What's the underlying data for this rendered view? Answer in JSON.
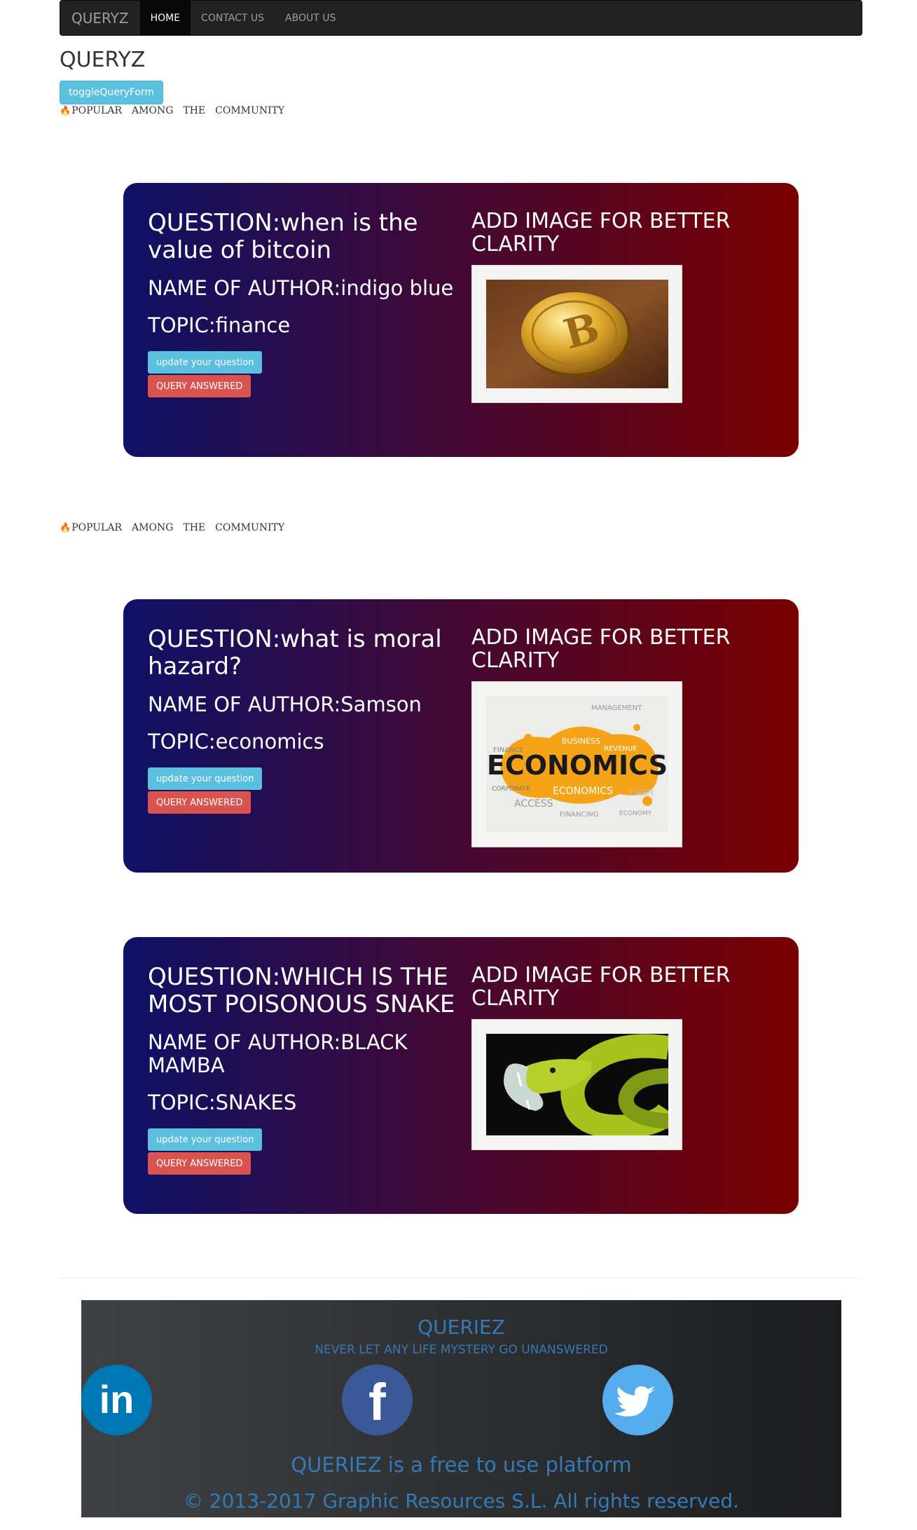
{
  "navbar": {
    "brand": "QUERYZ",
    "items": [
      {
        "label": "HOME",
        "active": true
      },
      {
        "label": "CONTACT US",
        "active": false
      },
      {
        "label": "ABOUT US",
        "active": false
      }
    ]
  },
  "page_title": "QUERYZ",
  "toggle_button": "toggleQueryForm",
  "popular_words": [
    "POPULAR",
    "AMONG",
    "THE",
    "COMMUNITY"
  ],
  "popular_icon": "fire-icon",
  "cards": [
    {
      "question": "QUESTION:when is the value of bitcoin",
      "author": "NAME OF AUTHOR:indigo blue",
      "topic": "TOPIC:finance",
      "update_label": "update your question",
      "answered_label": "QUERY ANSWERED",
      "add_image_label": "ADD IMAGE FOR BETTER CLARITY",
      "image": "bitcoin coin photo"
    },
    {
      "question": "QUESTION:what is moral hazard?",
      "author": "NAME OF AUTHOR:Samson",
      "topic": "TOPIC:economics",
      "update_label": "update your question",
      "answered_label": "QUERY ANSWERED",
      "add_image_label": "ADD IMAGE FOR BETTER CLARITY",
      "image": "economics word cloud",
      "image_words": {
        "main": "ECONOMICS",
        "small": [
          "MANAGEMENT",
          "BUSINESS",
          "FINANCE",
          "REVENUE",
          "CORPORATE",
          "ECONOMICS",
          "ACCESS",
          "FINANCING",
          "CASH",
          "ECONOMY"
        ]
      }
    },
    {
      "question": "QUESTION:WHICH IS THE MOST POISONOUS SNAKE",
      "author": "NAME OF AUTHOR:BLACK MAMBA",
      "topic": "TOPIC:SNAKES",
      "update_label": "update your question",
      "answered_label": "QUERY ANSWERED",
      "add_image_label": "ADD IMAGE FOR BETTER CLARITY",
      "image": "green viper snake photo"
    }
  ],
  "footer": {
    "title": "QUERIEZ",
    "subtitle": "NEVER LET ANY LIFE MYSTERY GO UNANSWERED",
    "social": [
      {
        "icon": "linkedin-icon",
        "glyph": "in",
        "color": "#0077b5"
      },
      {
        "icon": "facebook-icon",
        "glyph": "f",
        "color": "#3b5998"
      },
      {
        "icon": "twitter-icon",
        "color": "#55acee"
      }
    ],
    "free_text": "QUERIEZ is a free to use platform",
    "copyright": "© 2013-2017 Graphic Resources S.L. All rights reserved."
  },
  "colors": {
    "card_gradient_start": "#0e1166",
    "card_gradient_end": "#7a0000",
    "link_blue": "#337ab7",
    "info": "#5bc0de",
    "danger": "#d9534f"
  }
}
